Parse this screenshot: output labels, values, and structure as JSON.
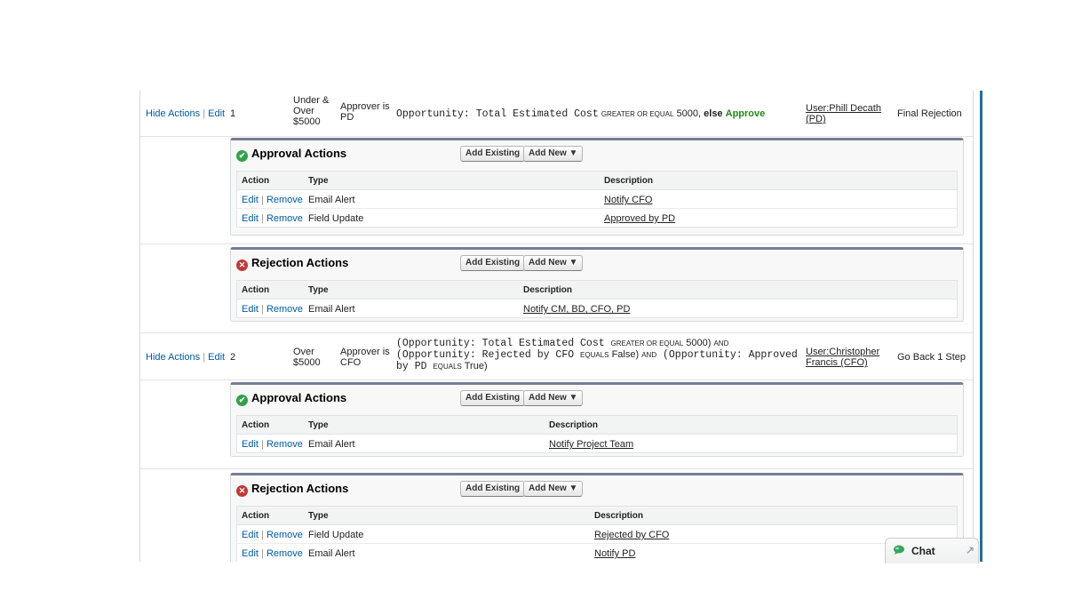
{
  "steps": [
    {
      "links": {
        "hide": "Hide Actions",
        "sep": "|",
        "edit": "Edit"
      },
      "num": "1",
      "name": [
        "Under &",
        "Over",
        "$5000"
      ],
      "approver": [
        "Approver is",
        "PD"
      ],
      "criteria": {
        "field": "Opportunity: Total Estimated Cost",
        "op": "GREATER OR EQUAL",
        "value": "5000",
        "comma": ",",
        "else": "else",
        "result": "Approve"
      },
      "assigned": [
        "User:Phill Decath",
        "(PD)"
      ],
      "reject_behavior": "Final Rejection"
    },
    {
      "links": {
        "hide": "Hide Actions",
        "sep": "|",
        "edit": "Edit"
      },
      "num": "2",
      "name": [
        "Over",
        "$5000"
      ],
      "approver": [
        "Approver is",
        "CFO"
      ],
      "criteria_lines": [
        {
          "a": "(Opportunity: Total Estimated Cost ",
          "b": "GREATER OR EQUAL",
          "c": " 5000) ",
          "d": "AND"
        },
        {
          "a": "(Opportunity: Rejected by CFO ",
          "b": "EQUALS",
          "c": " False) ",
          "d": "AND",
          "e": " (Opportunity: Approved"
        },
        {
          "a": "by PD ",
          "b": "EQUALS",
          "c": " True)"
        }
      ],
      "assigned": [
        "User:Christopher",
        "Francis (CFO)"
      ],
      "reject_behavior": "Go Back 1 Step"
    }
  ],
  "panels": [
    {
      "title": "Approval Actions",
      "icon": "check-icon",
      "add_existing": "Add Existing",
      "add_new": "Add New ▼",
      "headers": [
        "Action",
        "Type",
        "Description"
      ],
      "rows": [
        {
          "edit": "Edit",
          "sep": "|",
          "remove": "Remove",
          "type": "Email Alert",
          "desc": "Notify CFO"
        },
        {
          "edit": "Edit",
          "sep": "|",
          "remove": "Remove",
          "type": "Field Update",
          "desc": "Approved by PD"
        }
      ]
    },
    {
      "title": "Rejection Actions",
      "icon": "x-icon",
      "add_existing": "Add Existing",
      "add_new": "Add New ▼",
      "headers": [
        "Action",
        "Type",
        "Description"
      ],
      "rows": [
        {
          "edit": "Edit",
          "sep": "|",
          "remove": "Remove",
          "type": "Email Alert",
          "desc": "Notify CM, BD, CFO, PD"
        }
      ]
    },
    {
      "title": "Approval Actions",
      "icon": "check-icon",
      "add_existing": "Add Existing",
      "add_new": "Add New ▼",
      "headers": [
        "Action",
        "Type",
        "Description"
      ],
      "rows": [
        {
          "edit": "Edit",
          "sep": "|",
          "remove": "Remove",
          "type": "Email Alert",
          "desc": "Notify Project Team"
        }
      ]
    },
    {
      "title": "Rejection Actions",
      "icon": "x-icon",
      "add_existing": "Add Existing",
      "add_new": "Add New ▼",
      "headers": [
        "Action",
        "Type",
        "Description"
      ],
      "rows": [
        {
          "edit": "Edit",
          "sep": "|",
          "remove": "Remove",
          "type": "Field Update",
          "desc": "Rejected by CFO"
        },
        {
          "edit": "Edit",
          "sep": "|",
          "remove": "Remove",
          "type": "Email Alert",
          "desc": "Notify PD"
        }
      ]
    }
  ],
  "chat": {
    "label": "Chat",
    "icon": "chat-bubble-icon",
    "expand_icon": "expand-arrow-icon"
  },
  "colors": {
    "accent": "#1f6e9a",
    "link": "#015ba7",
    "approve": "#1e8a16",
    "ok_icon": "#2fa34a",
    "no_icon": "#c23934"
  }
}
